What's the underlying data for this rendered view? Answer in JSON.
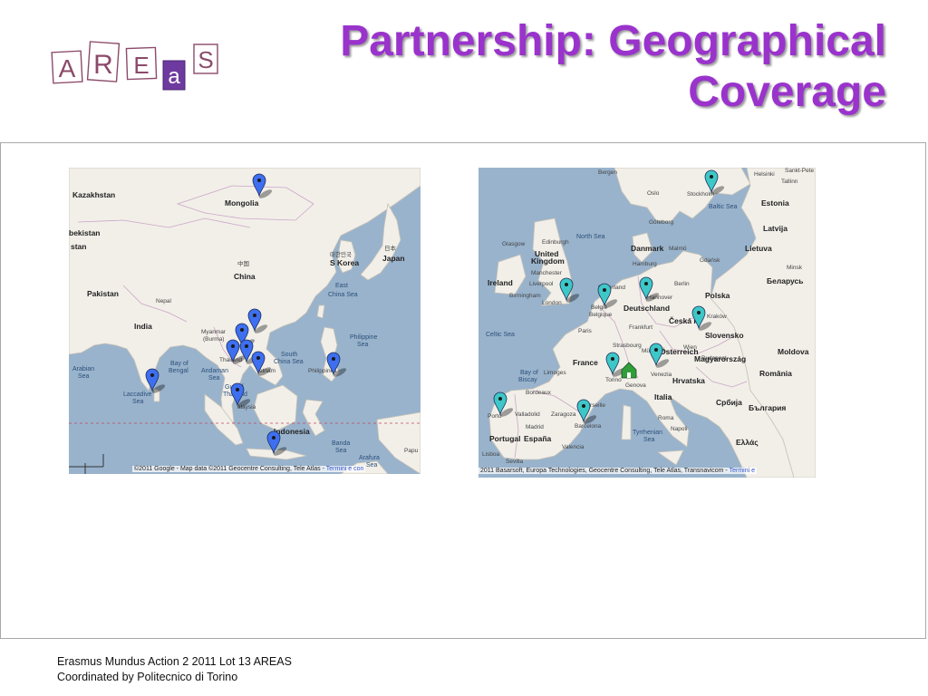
{
  "slide": {
    "title_line1": "Partnership: Geographical",
    "title_line2": "Coverage",
    "logo_letters": [
      "A",
      "R",
      "E",
      "a",
      "S"
    ]
  },
  "asia_map": {
    "labels": {
      "kazakhstan": "Kazakhstan",
      "mongolia": "Mongolia",
      "uzbekistan": "bekistan",
      "stan": "stan",
      "china_local": "中国",
      "china": "China",
      "korea_local": "대한민국",
      "korea": "S Korea",
      "japan_local": "日本",
      "japan": "Japan",
      "pakistan": "Pakistan",
      "nepal": "Nepal",
      "india": "India",
      "east_china_sea_1": "East",
      "east_china_sea_2": "China Sea",
      "myanmar_1": "Myanmar",
      "myanmar_2": "(Burma)",
      "thailand": "Thailand",
      "vietnam": "etnam",
      "philippine_sea_1": "Philippine",
      "philippine_sea_2": "Sea",
      "south_china_sea_1": "South",
      "south_china_sea_2": "China Sea",
      "arabian_sea_1": "Arabian",
      "arabian_sea_2": "Sea",
      "bay_of_bengal_1": "Bay of",
      "bay_of_bengal_2": "Bengal",
      "andaman_sea_1": "Andaman",
      "andaman_sea_2": "Sea",
      "philippines": "Philippines",
      "gulf_1": "Gulf of",
      "gulf_2": "Thailand",
      "laccadive_1": "Laccadive",
      "laccadive_2": "Sea",
      "malaysia": "alaysia",
      "indonesia": "Indonesia",
      "banda_sea_1": "Banda",
      "banda_sea_2": "Sea",
      "arafura_sea_1": "Arafura",
      "arafura_sea_2": "Sea",
      "papua": "Papu"
    },
    "copyright": "©2011 Google - Map data ©2011 Geocentre Consulting, Tele Atlas - ",
    "terms": "Termini e con",
    "marker_color": "#3e6ff0"
  },
  "europe_map": {
    "labels": {
      "bergen": "Bergen",
      "helsinki": "Helsinki",
      "saint_petersburg": "Sankt-Pete",
      "oslo": "Oslo",
      "stockholm": "Stockholm",
      "tallinn": "Tallinn",
      "baltic_sea": "Baltic Sea",
      "estonia": "Estonia",
      "goteborg": "Göteborg",
      "north_sea": "North Sea",
      "latvija": "Latvija",
      "glasgow": "Glasgow",
      "edinburgh": "Edinburgh",
      "denmark": "Danmark",
      "malmo": "Malmö",
      "lietuva": "Lietuva",
      "united": "United",
      "kingdom": "Kingdom",
      "hamburg": "Hamburg",
      "gdansk": "Gdańsk",
      "minsk": "Minsk",
      "manchester": "Manchester",
      "ireland": "Ireland",
      "liverpool": "Liverpool",
      "nederland": "Nederland",
      "hannover": "Hannover",
      "berlin": "Berlin",
      "polska": "Polska",
      "belarus": "Беларусь",
      "birmingham": "Birmingham",
      "london": "London",
      "belgie": "België",
      "belgique": "Belgique",
      "deutschland": "Deutschland",
      "celtic_sea": "Celtic Sea",
      "frankfurt": "Frankfurt",
      "ceska": "Česká R",
      "krakow": "Kraków",
      "paris": "Paris",
      "strasbourg": "Strasbourg",
      "munchen": "München",
      "wien": "Wien",
      "slovensko": "Slovensko",
      "osterreich": "Österreich",
      "bay_of_biscay_1": "Bay of",
      "bay_of_biscay_2": "Biscay",
      "france": "France",
      "budapest": "Budapest",
      "moldova": "Moldova",
      "magyarorszag": "Magyarország",
      "limoges": "Limoges",
      "venezia": "Venezia",
      "hrvatska": "Hrvatska",
      "romania": "România",
      "torino": "Torino",
      "genova": "Genova",
      "bordeaux": "Bordeaux",
      "srbija": "Србија",
      "marseille": "Marseille",
      "italia": "Italia",
      "balgaria": "България",
      "porto": "Porto",
      "valladolid": "Valladolid",
      "zaragoza": "Zaragoza",
      "roma": "Roma",
      "madrid": "Madrid",
      "barcelona": "Barcelona",
      "portugal": "Portugal",
      "espana": "España",
      "napoli": "Napoli",
      "tyrrhenian_1": "Tyrrhenian",
      "tyrrhenian_2": "Sea",
      "ellas": "Ελλάς",
      "lisboa": "Lisboa",
      "valencia": "Valencia",
      "sevilla": "Sevilla"
    },
    "copyright": "2011 Basarsoft, Europa Technologies, Geocentre Consulting, Tele Atlas, Transnavicom - ",
    "terms": "Termini e",
    "marker_color": "#3ec7c7",
    "home_marker_color": "#2f9e3a"
  },
  "footer": {
    "line1": "Erasmus Mundus Action 2 2011 Lot 13 AREAS",
    "line2": "Coordinated by Politecnico di Torino"
  },
  "colors": {
    "title": "#9a33cc",
    "logo_letters": "#8b4a6a",
    "logo_highlight": "#6e3aa0",
    "land": "#f2efe9",
    "water": "#99b3cc"
  }
}
